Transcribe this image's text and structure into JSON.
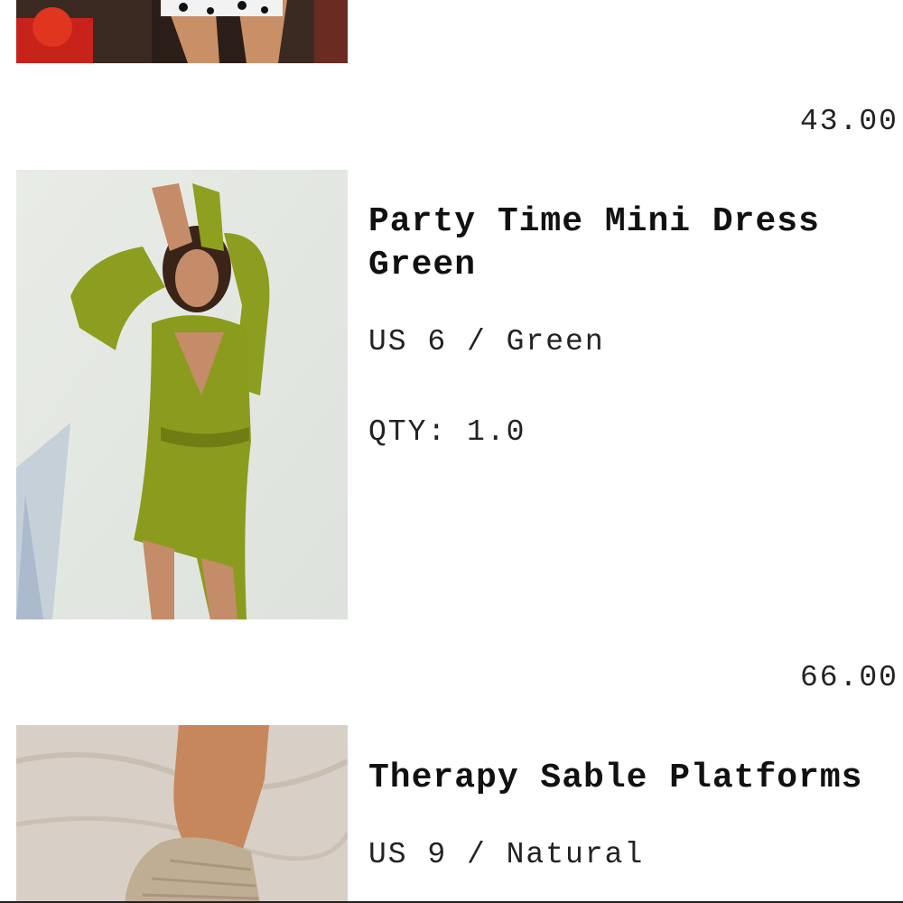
{
  "cart": {
    "items": [
      {
        "title": "",
        "variant": "",
        "qty": "",
        "price": "43.00",
        "image_icon": "product-photo-icon"
      },
      {
        "title": "Party Time Mini Dress Green",
        "variant": "US 6 / Green",
        "qty": "QTY: 1.0",
        "price": "66.00",
        "image_icon": "product-photo-icon"
      },
      {
        "title": "Therapy Sable Platforms",
        "variant": "US 9 / Natural",
        "qty": "",
        "price": "",
        "image_icon": "product-photo-icon"
      }
    ]
  },
  "colors": {
    "background": "#ffffff",
    "text": "#111111",
    "dress_green": "#8c9a1f"
  }
}
